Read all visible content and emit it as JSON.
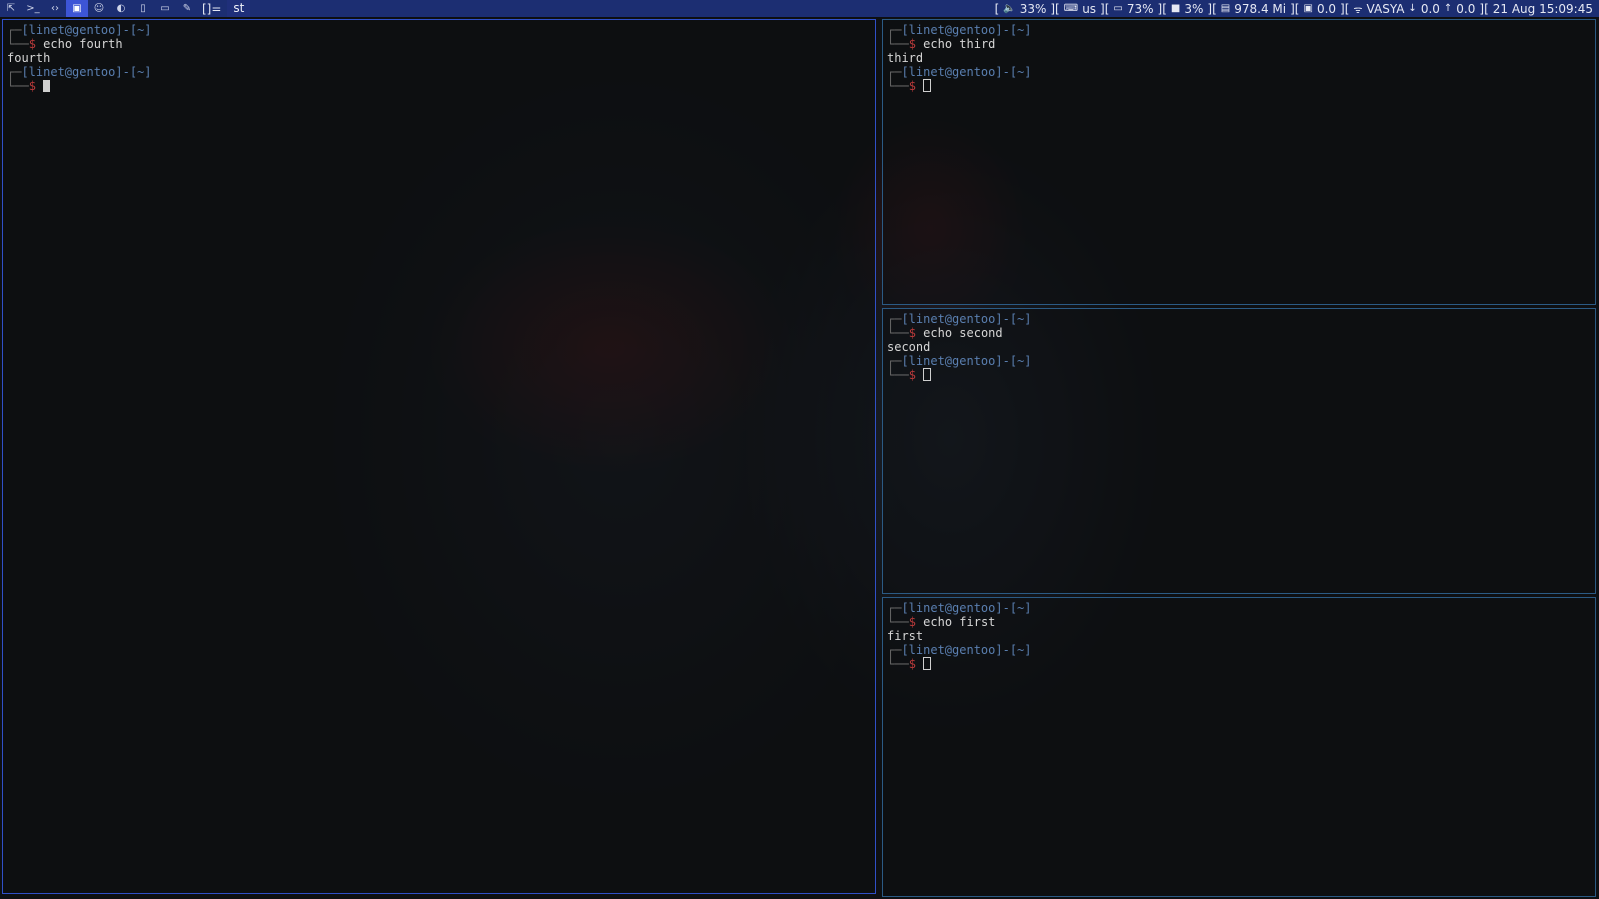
{
  "bar": {
    "tags": [
      {
        "glyph": "⇱",
        "name": "tag-1-icon",
        "active": false
      },
      {
        "glyph": ">_",
        "name": "tag-2-terminal-icon",
        "active": false
      },
      {
        "glyph": "‹›",
        "name": "tag-3-code-icon",
        "active": false
      },
      {
        "glyph": "▣",
        "name": "tag-4-window-icon",
        "active": true
      },
      {
        "glyph": "☺",
        "name": "tag-5-chat-icon",
        "active": false
      },
      {
        "glyph": "◐",
        "name": "tag-6-moon-icon",
        "active": false
      },
      {
        "glyph": "▯",
        "name": "tag-7-file-icon",
        "active": false
      },
      {
        "glyph": "▭",
        "name": "tag-8-image-icon",
        "active": false
      },
      {
        "glyph": "✎",
        "name": "tag-9-brush-icon",
        "active": false
      }
    ],
    "layout_symbol": "[]=",
    "window_title": "st",
    "status": {
      "volume": "33%",
      "keyboard": "us",
      "battery": "73%",
      "cpu": "3%",
      "memory": "978.4 Mi",
      "disk": "0.0",
      "wifi": "VASYA",
      "down": "0.0",
      "up": "0.0",
      "datetime": "21 Aug 15:09:45"
    }
  },
  "terminals": {
    "fourth": {
      "user_line": "[linet@gentoo]-[~]",
      "command": "echo fourth",
      "output": "fourth",
      "user_line_2": "[linet@gentoo]-[~]"
    },
    "third": {
      "user_line": "[linet@gentoo]-[~]",
      "command": "echo third",
      "output": "third",
      "user_line_2": "[linet@gentoo]-[~]"
    },
    "second": {
      "user_line": "[linet@gentoo]-[~]",
      "command": "echo second",
      "output": "second",
      "user_line_2": "[linet@gentoo]-[~]"
    },
    "first": {
      "user_line": "[linet@gentoo]-[~]",
      "command": "echo first",
      "output": "first",
      "user_line_2": "[linet@gentoo]-[~]"
    }
  },
  "colors": {
    "bar_bg": "#1c2e72",
    "active_tag": "#3d55d6",
    "focused_border": "#3050c8",
    "normal_border": "#2b5a84",
    "prompt_user": "#5a7fb0",
    "prompt_dollar": "#b83a3a"
  }
}
